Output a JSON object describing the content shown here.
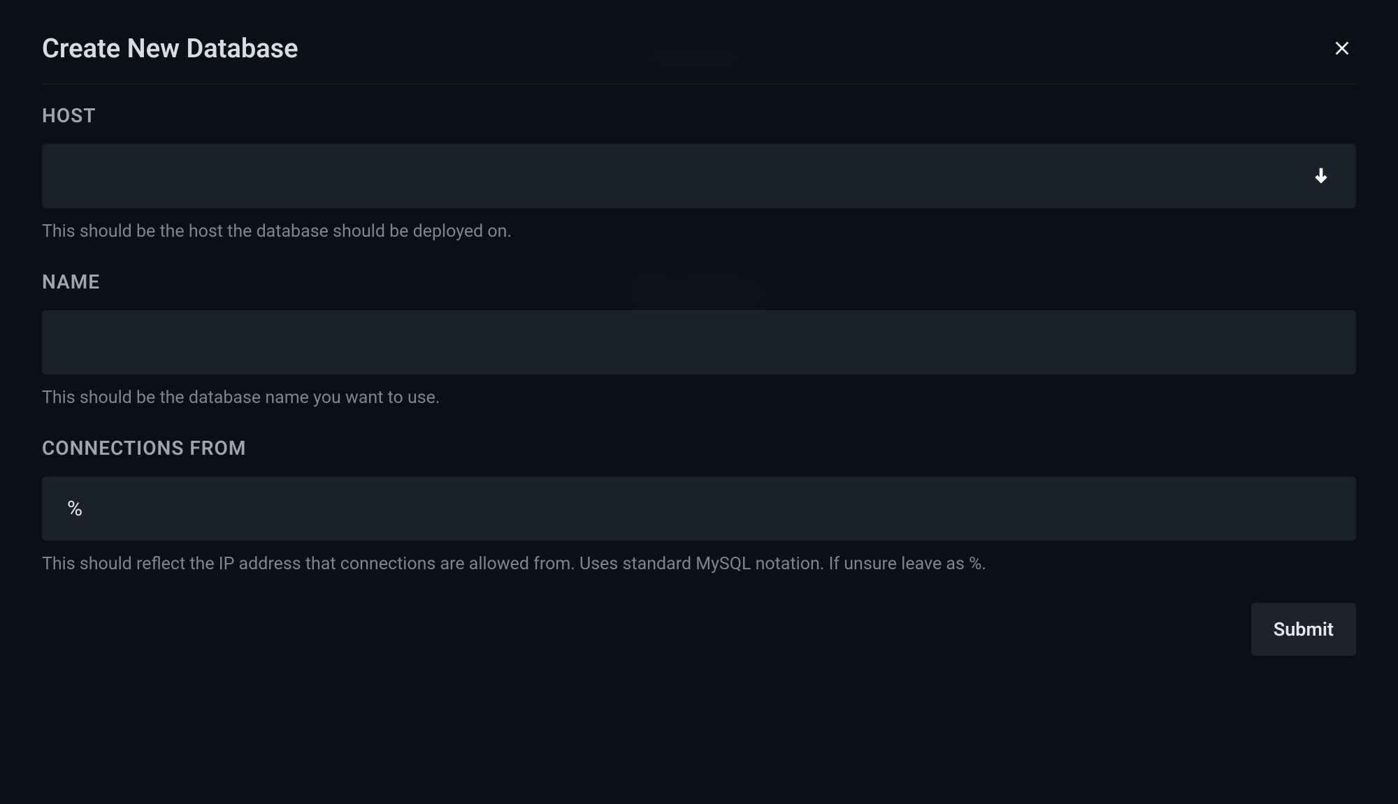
{
  "modal": {
    "title": "Create New Database",
    "fields": {
      "host": {
        "label": "HOST",
        "value": "",
        "help": "This should be the host the database should be deployed on."
      },
      "name": {
        "label": "NAME",
        "value": "",
        "help": "This should be the database name you want to use."
      },
      "connections_from": {
        "label": "CONNECTIONS FROM",
        "value": "%",
        "help": "This should reflect the IP address that connections are allowed from. Uses standard MySQL notation. If unsure leave as %."
      }
    },
    "submit_label": "Submit"
  }
}
